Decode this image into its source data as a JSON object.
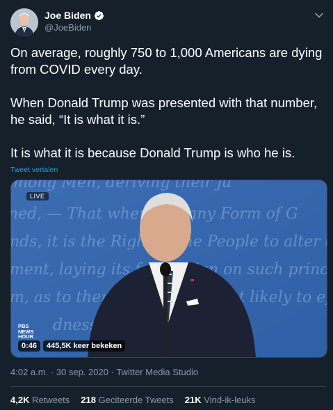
{
  "author": {
    "name": "Joe Biden",
    "handle": "@JoeBiden"
  },
  "tweet": {
    "paragraphs": [
      "On average, roughly 750 to 1,000 Americans are dying from COVID every day.",
      "When Donald Trump was presented with that number, he said, “It is what it is.”",
      "It is what it is because Donald Trump is who he is."
    ],
    "translate_label": "Tweet vertalen"
  },
  "video": {
    "live_badge": "LIVE",
    "channel_logo": "PBS NEWS HOUR",
    "duration": "0:46",
    "views": "445,5K keer bekeken",
    "background_text": [
      "among Men, deriving their ju",
      "ned, — That whenever any Form of G",
      "nds, it is the Right of the People to alter or",
      "ment, laying its foundation on such princi",
      "m, as to them shall seem most likely to effe",
      "dness — Government"
    ]
  },
  "meta": {
    "time": "4:02 a.m.",
    "separator": "·",
    "date": "30 sep. 2020",
    "source": "Twitter Media Studio"
  },
  "stats": {
    "retweets_count": "4,2K",
    "retweets_label": "Retweets",
    "quotes_count": "218",
    "quotes_label": "Geciteerde Tweets",
    "likes_count": "21K",
    "likes_label": "Vind-ik-leuks"
  },
  "colors": {
    "background": "#15202b",
    "secondary_text": "#8899a6",
    "accent": "#1da1f2",
    "verified": "#ffffff",
    "video_bg": "#3f6fb4"
  }
}
